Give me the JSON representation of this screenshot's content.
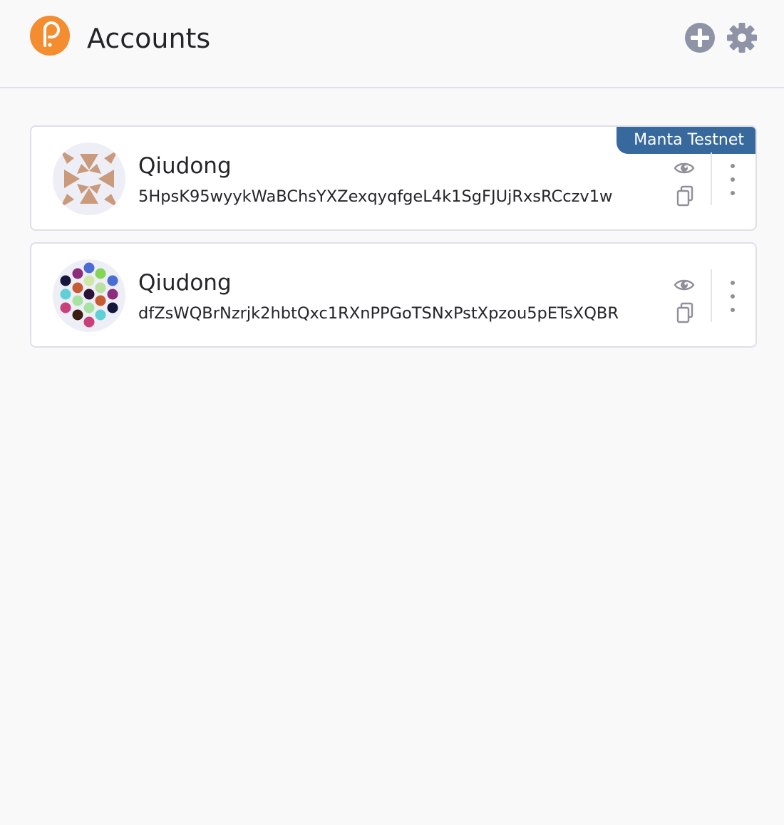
{
  "header": {
    "title": "Accounts",
    "logo_icon": "polkadot-logo-icon",
    "add_icon": "add-circle-icon",
    "settings_icon": "gear-icon"
  },
  "colors": {
    "brand_orange": "#f48d2f",
    "icon_gray": "#8e93a6",
    "badge_blue": "#38699c"
  },
  "accounts": [
    {
      "name": "Qiudong",
      "address": "5HpsK95wyykWaBChsYXZexqyqfgeL4k1SgFJUjRxsRCczv1w",
      "network": "Manta Testnet",
      "avatar_icon": "identicon-star-icon"
    },
    {
      "name": "Qiudong",
      "address": "dfZsWQBrNzrjk2hbtQxc1RXnPPGoTSNxPstXpzou5pETsXQBR",
      "avatar_icon": "identicon-dots-icon"
    }
  ]
}
